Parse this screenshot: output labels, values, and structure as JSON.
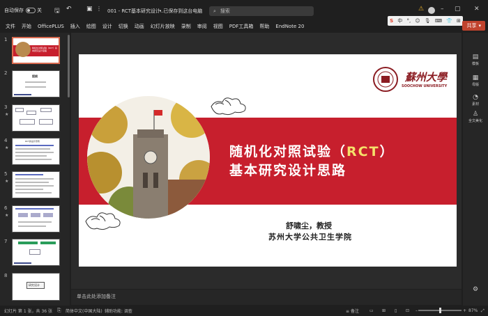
{
  "titlebar": {
    "autosave_label": "自动保存",
    "autosave_state": "关",
    "doc_title": "001 - RCT基本研究设计...",
    "save_status": "• 已保存到这台电脑",
    "search_placeholder": "搜索"
  },
  "menu": [
    "文件",
    "开始",
    "OfficePLUS",
    "插入",
    "绘图",
    "设计",
    "切换",
    "动画",
    "幻灯片放映",
    "录制",
    "审阅",
    "视图",
    "PDF工具箱",
    "帮助",
    "EndNote 20"
  ],
  "share_label": "共享",
  "ime": {
    "logo": "S",
    "lang": "中"
  },
  "thumbnails": [
    {
      "num": "1",
      "title": "随机化对照试验（RCT）基本研究设计思路"
    },
    {
      "num": "2",
      "title": "提纲"
    },
    {
      "num": "3",
      "title": ""
    },
    {
      "num": "4",
      "title": "RCT的设计原则"
    },
    {
      "num": "5",
      "title": ""
    },
    {
      "num": "6",
      "title": ""
    },
    {
      "num": "7",
      "title": ""
    },
    {
      "num": "8",
      "title": "研究设计"
    }
  ],
  "slide": {
    "university_cn": "蘇州大學",
    "university_en": "SOOCHOW UNIVERSITY",
    "title_line1_a": "随机化对照试验（",
    "title_line1_rct": "RCT",
    "title_line1_b": "）",
    "title_line2": "基本研究设计思路",
    "author": "舒啸尘，教授",
    "school": "苏州大学公共卫生学院"
  },
  "side_panel": [
    "模板",
    "母版",
    "素材",
    "全文美化"
  ],
  "notes_placeholder": "单击此处添加备注",
  "status": {
    "slide_info": "幻灯片 第 1 张，共 36 张",
    "language": "简体中文(中国大陆)",
    "accessibility": "辅助功能: 调查",
    "notes": "备注",
    "zoom": "87%"
  },
  "colors": {
    "band": "#c71f2d",
    "accent": "#c0432d",
    "logo": "#8b1c22"
  }
}
